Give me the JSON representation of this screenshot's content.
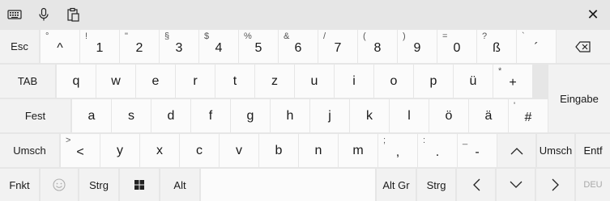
{
  "toolbar": {
    "icons": [
      "keyboard-layout-icon",
      "microphone-icon",
      "clipboard-icon"
    ],
    "close_label": "✕"
  },
  "row1": [
    {
      "main": "Esc",
      "label": true
    },
    {
      "sub": "°",
      "main": "^"
    },
    {
      "sub": "!",
      "main": "1"
    },
    {
      "sub": "\"",
      "main": "2"
    },
    {
      "sub": "§",
      "main": "3"
    },
    {
      "sub": "$",
      "main": "4"
    },
    {
      "sub": "%",
      "main": "5"
    },
    {
      "sub": "&",
      "main": "6"
    },
    {
      "sub": "/",
      "main": "7"
    },
    {
      "sub": "(",
      "main": "8"
    },
    {
      "sub": ")",
      "main": "9"
    },
    {
      "sub": "=",
      "main": "0"
    },
    {
      "sub": "?",
      "main": "ß"
    },
    {
      "sub": "`",
      "main": "´"
    }
  ],
  "row2": [
    {
      "main": "TAB",
      "label": true
    },
    {
      "main": "q"
    },
    {
      "main": "w"
    },
    {
      "main": "e"
    },
    {
      "main": "r"
    },
    {
      "main": "t"
    },
    {
      "main": "z"
    },
    {
      "main": "u"
    },
    {
      "main": "i"
    },
    {
      "main": "o"
    },
    {
      "main": "p"
    },
    {
      "main": "ü"
    },
    {
      "sub": "*",
      "main": "+"
    }
  ],
  "row3": [
    {
      "main": "Fest",
      "label": true
    },
    {
      "main": "a"
    },
    {
      "main": "s"
    },
    {
      "main": "d"
    },
    {
      "main": "f"
    },
    {
      "main": "g"
    },
    {
      "main": "h"
    },
    {
      "main": "j"
    },
    {
      "main": "k"
    },
    {
      "main": "l"
    },
    {
      "main": "ö"
    },
    {
      "main": "ä"
    },
    {
      "sub": "'",
      "main": "#"
    }
  ],
  "enter_label": "Eingabe",
  "row4": [
    {
      "main": "Umsch",
      "label": true
    },
    {
      "sub": ">",
      "main": "<"
    },
    {
      "main": "y"
    },
    {
      "main": "x"
    },
    {
      "main": "c"
    },
    {
      "main": "v"
    },
    {
      "main": "b"
    },
    {
      "main": "n"
    },
    {
      "main": "m"
    },
    {
      "sub": ";",
      "main": ","
    },
    {
      "sub": ":",
      "main": "."
    },
    {
      "sub": "_",
      "main": "-"
    },
    {
      "main": "^",
      "arrow": "up"
    },
    {
      "main": "Umsch",
      "label": true
    },
    {
      "main": "Entf",
      "label": true
    }
  ],
  "row5": {
    "fnkt": "Fnkt",
    "emoji": "emoji-icon",
    "strg": "Strg",
    "win": "windows-icon",
    "alt": "Alt",
    "space": "",
    "altgr": "Alt Gr",
    "strg2": "Strg",
    "lang": "DEU"
  }
}
